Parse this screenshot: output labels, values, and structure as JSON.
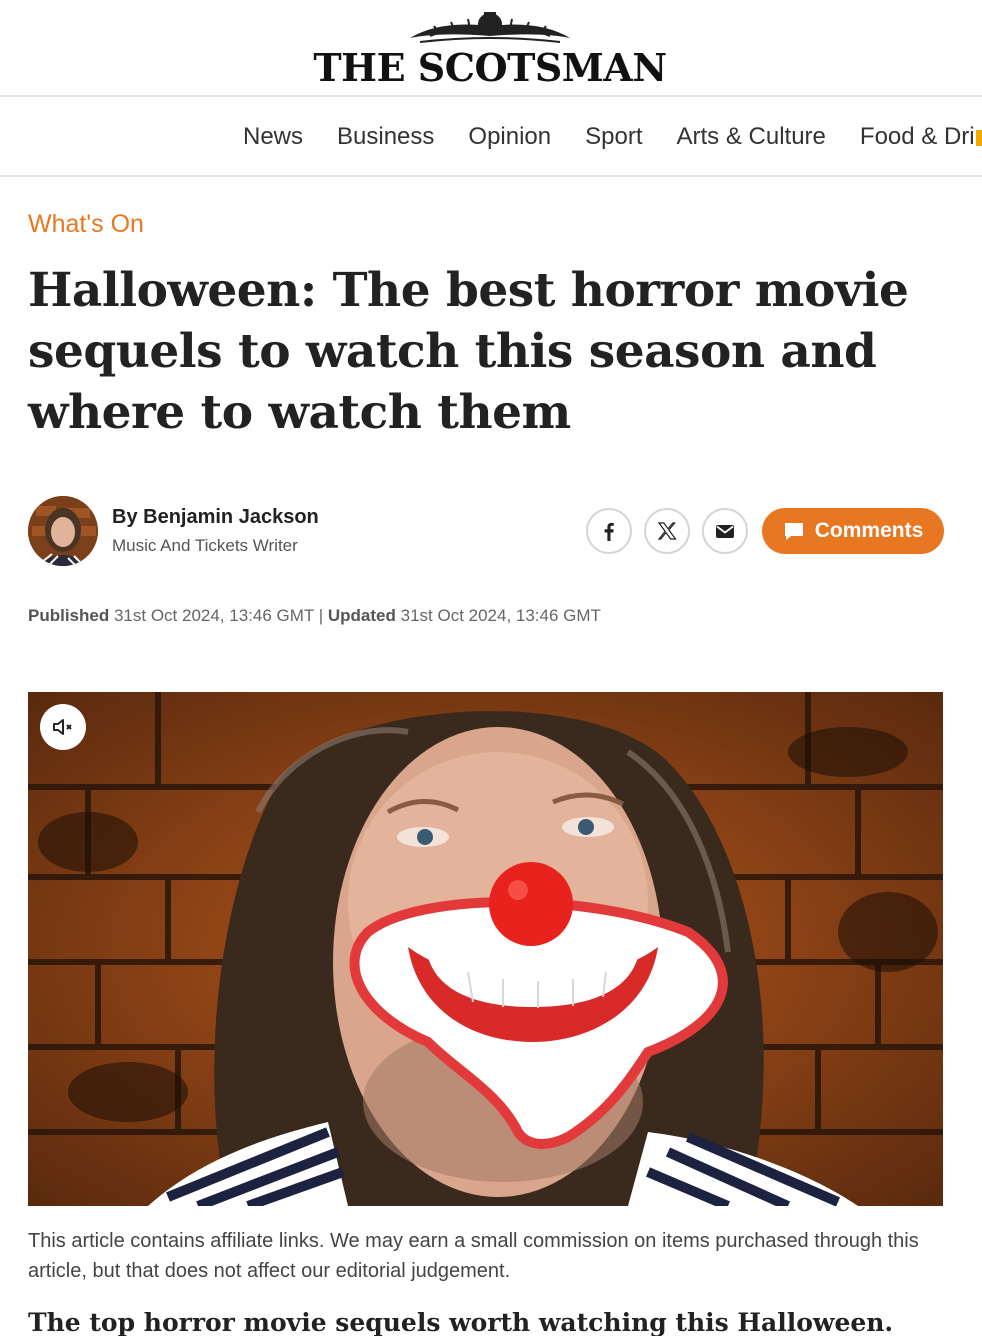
{
  "site": {
    "name": "THE SCOTSMAN"
  },
  "nav": {
    "items": [
      "News",
      "Business",
      "Opinion",
      "Sport",
      "Arts & Culture",
      "Food & Drink"
    ]
  },
  "article": {
    "section": "What's On",
    "headline": "Halloween: The best horror movie sequels to watch this season and where to watch them",
    "author": {
      "name": "By Benjamin Jackson",
      "role": "Music And Tickets Writer"
    },
    "share": {
      "icons": [
        "facebook-icon",
        "x-icon",
        "email-icon"
      ],
      "comments_label": "Comments"
    },
    "published_label": "Published",
    "published_value": "31st Oct 2024, 13:46 GMT",
    "separator": "|",
    "updated_label": "Updated",
    "updated_value": "31st Oct 2024, 13:46 GMT",
    "disclaimer": "This article contains affiliate links. We may earn a small commission on items purchased through this article, but that does not affect our editorial judgement.",
    "subhead": "The top horror movie sequels worth watching this Halloween."
  },
  "colors": {
    "accent": "#e87722",
    "text": "#222222"
  }
}
